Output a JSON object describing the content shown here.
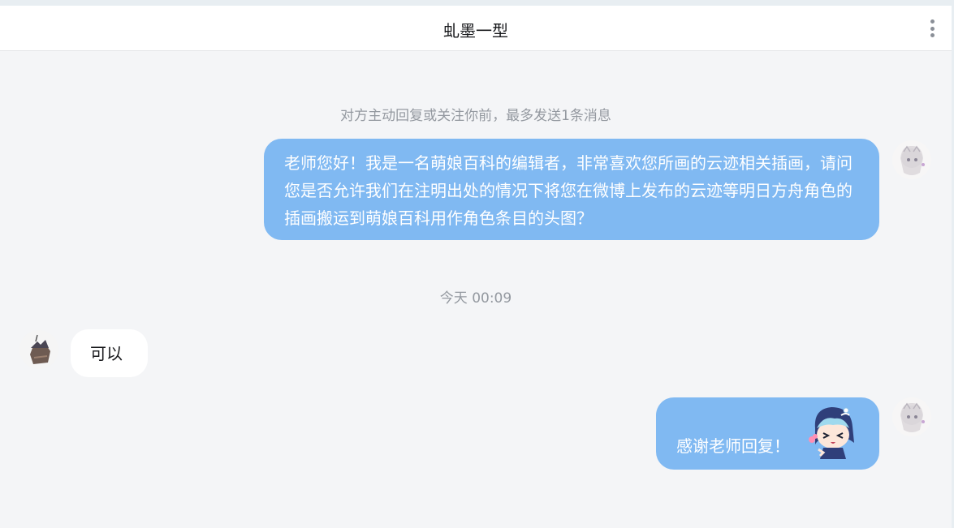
{
  "header": {
    "title": "虬墨一型",
    "more_icon": "more-vertical-icon"
  },
  "notices": {
    "limit": "对方主动回复或关注你前，最多发送1条消息",
    "time": "今天 00:09"
  },
  "messages": [
    {
      "sender": "me",
      "text": "老师您好！我是一名萌娘百科的编辑者，非常喜欢您所画的云迹相关插画，请问您是否允许我们在注明出处的情况下将您在微博上发布的云迹等明日方舟角色的插画搬运到萌娘百科用作角色条目的头图？"
    },
    {
      "sender": "them",
      "text": "可以"
    },
    {
      "sender": "me",
      "text": "感谢老师回复！",
      "sticker": "chibi-character-sticker"
    }
  ],
  "colors": {
    "my_bubble": "#80b9f2",
    "their_bubble": "#ffffff",
    "background": "#f4f5f7"
  }
}
